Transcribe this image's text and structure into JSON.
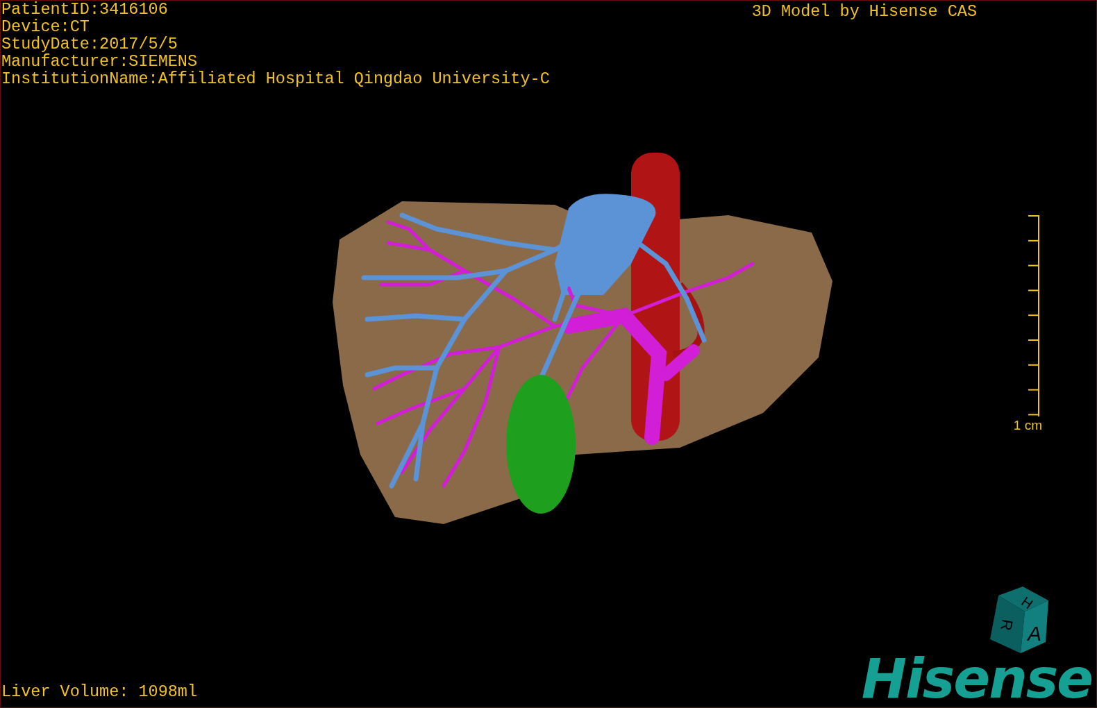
{
  "info_lines": [
    "PatientID:3416106",
    "Device:CT",
    "StudyDate:2017/5/5",
    "Manufacturer:SIEMENS",
    "InstitutionName:Affiliated Hospital Qingdao University-C"
  ],
  "title": "3D Model by Hisense CAS",
  "scale_bar": {
    "label": "1 cm"
  },
  "orientation_cube": {
    "faces": [
      "H",
      "R",
      "A"
    ]
  },
  "liver_volume": "Liver Volume: 1098ml",
  "logo": "Hisense"
}
